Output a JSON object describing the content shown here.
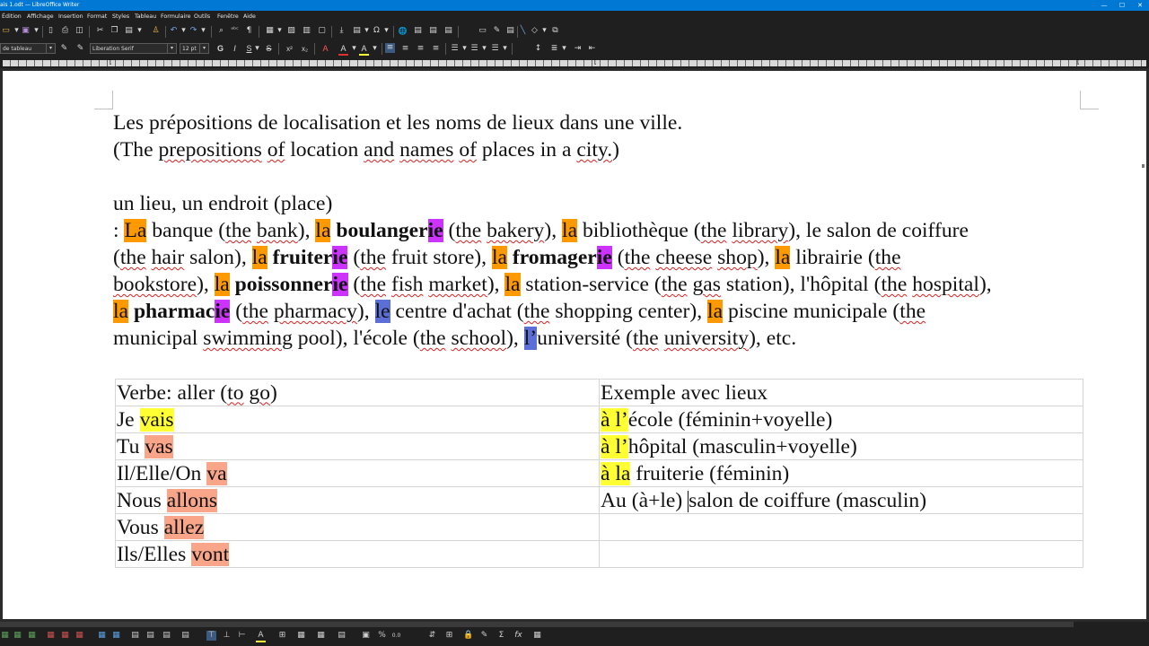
{
  "window": {
    "title": "ais 1.odt — LibreOffice Writer",
    "minimize_glyph": "—",
    "maximize_glyph": "☐",
    "close_glyph": "✕"
  },
  "menu": [
    "Édition",
    "Affichage",
    "Insertion",
    "Format",
    "Styles",
    "Tableau",
    "Formulaire",
    "Outils",
    "Fenêtre",
    "Aide"
  ],
  "toolbar": {
    "paragraph_style": "de tableau",
    "font_name": "Liberation Serif",
    "font_size": "12 pt",
    "bold": "G",
    "italic": "I",
    "underline": "S",
    "strikethrough": "S",
    "superscript": "x²",
    "subscript": "x₂",
    "font_color": "A",
    "highlight": "A"
  },
  "document": {
    "title_line1": "Les prépositions de localisation et les noms de lieux dans une ville.",
    "title_line2": {
      "a": "(The ",
      "b": "prepositions",
      "c": " ",
      "d": "of",
      "e": " location ",
      "f": "and",
      "g": " ",
      "h": "names",
      "i": " ",
      "j": "of",
      "k": " places in a ",
      "l": "city.",
      "m": ")"
    },
    "place_heading": "un lieu, un endroit (place)",
    "para": {
      "l1": {
        "a": ": ",
        "b": "La",
        "c": " banque (",
        "d": "the",
        "e": " ",
        "f": "bank",
        "g": "), ",
        "h": "la",
        "i": " ",
        "j": "boulanger",
        "k": "ie",
        "l": " (",
        "m": "the",
        "n": " ",
        "o": "bakery",
        "p": "), ",
        "q": "la",
        "r": " bibliothèque (",
        "s": "the",
        "t": " ",
        "u": "library",
        "v": "), le salon de coiffure"
      },
      "l2": {
        "a": "(",
        "b": "the",
        "c": " ",
        "d": "hair",
        "e": " salon), ",
        "f": "la",
        "g": " ",
        "h": "fruiter",
        "i": "ie",
        "j": " (",
        "k": "the",
        "l": " fruit store), ",
        "m": "la",
        "n": " ",
        "o": "fromager",
        "p": "ie",
        "q": " (",
        "r": "the",
        "s": " ",
        "t": "cheese",
        "u": " ",
        "v": "shop",
        "w": "), ",
        "x": "la",
        "y": " librairie (",
        "z": "the"
      },
      "l3": {
        "a": "bookstore",
        "b": "), ",
        "c": "la",
        "d": " ",
        "e": "poissonner",
        "f": "ie",
        "g": " (",
        "h": "the",
        "i": " ",
        "j": "fish",
        "k": " ",
        "l": "market",
        "m": "), ",
        "n": "la",
        "o": " station-service (",
        "p": "the",
        "q": " ",
        "r": "gas",
        "s": " station), l'hôpital (",
        "t": "the",
        "u": " ",
        "v": "hospital",
        "w": "),"
      },
      "l4": {
        "a": "la",
        "b": " ",
        "c": "pharmac",
        "d": "ie",
        "e": " (",
        "f": "the",
        "g": " ",
        "h": "pharmacy",
        "i": "), ",
        "j": "le",
        "k": " centre d'achat (",
        "l": "the",
        "m": " shopping center), ",
        "n": "la",
        "o": " piscine municipale (",
        "p": "the"
      },
      "l5": {
        "a": "municipal ",
        "b": "swimming",
        "c": " pool), l'école (",
        "d": "the",
        "e": " ",
        "f": "school",
        "g": "), ",
        "h": "l’",
        "i": "université (",
        "j": "the",
        "k": " ",
        "l": "university",
        "m": "), etc."
      }
    },
    "table": {
      "header": {
        "c1a": "Verbe: aller (",
        "c1b": "to",
        "c1c": " ",
        "c1d": "go",
        "c1e": ")",
        "c2": "Exemple avec lieux"
      },
      "rows": [
        {
          "pronoun": "Je ",
          "verb": "vais",
          "ex_hl": "à l’",
          "ex": "école  (féminin+voyelle)"
        },
        {
          "pronoun": "Tu ",
          "verb": "vas",
          "ex_hl": "à l’",
          "ex": "hôpital (masculin+voyelle)"
        },
        {
          "pronoun": "Il/Elle/On ",
          "verb": "va",
          "ex_hl": "à la",
          "ex": " fruiterie (féminin)"
        },
        {
          "pronoun": "Nous ",
          "verb": "allons",
          "ex_a": "Au (à+le) ",
          "ex_b": "salon de coiffure  (masculin)"
        },
        {
          "pronoun": "Vous ",
          "verb": "allez"
        },
        {
          "pronoun": "Ils/Elles ",
          "verb": "vont"
        }
      ]
    }
  },
  "colors": {
    "article_highlight": "#ff9900",
    "suffix_highlight": "#cc33ff",
    "masculine_highlight": "#5b6fd6",
    "example_highlight": "#ffff33",
    "verb_highlight": "#f9a58a",
    "titlebar": "#0078d4",
    "ui_dark": "#1f1f1f"
  },
  "icons": {
    "glyphs": {
      "open": "▭",
      "save": "▣",
      "dropdown": "▾",
      "new": "▯",
      "pdf": "▤",
      "print": "⎙",
      "preview": "◫",
      "cut": "✂",
      "copy": "❐",
      "paste": "▤",
      "clone": "♙",
      "undo": "↶",
      "redo": "↷",
      "find": "⌕",
      "spellcheck": "ᵃᵇᶜ",
      "formatting_marks": "¶",
      "table": "▦",
      "image": "▨",
      "chart": "▥",
      "textbox": "▢",
      "page_break": "⤓",
      "field": "▤",
      "special_char": "Ω",
      "hyperlink": "🌐",
      "footnote": "▤",
      "bookmark": "▤",
      "cross_reference": "▤",
      "comment": "▭",
      "track_changes": "✎",
      "header_footer": "▤",
      "line": "╲",
      "shapes": "◇",
      "more": "⧉",
      "style_new": "✎",
      "style_update": "✎",
      "align_left": "≡",
      "align_center": "≡",
      "align_right": "≡",
      "justify": "≡",
      "bullets": "☰",
      "numbering": "☰",
      "outline": "☰",
      "line_spacing": "↕",
      "para_spacing": "≣",
      "indent_inc": "⇥",
      "indent_dec": "⇤",
      "tab_marker": "⌊",
      "bottom": [
        "▦",
        "▦",
        "▦",
        "▦",
        "▦",
        "▦",
        "▦",
        "▦",
        "▦",
        "▦",
        "▦",
        "▤",
        "▤",
        "▤",
        "▤",
        "▤",
        "▤",
        "⊤",
        "⊥",
        "⊢",
        "A",
        "⊞",
        "▦",
        "▦",
        "▤",
        "▣",
        "%",
        "0.0",
        "⇵",
        "⊞",
        "🔒",
        "✎",
        "Σ",
        "fx",
        "▦"
      ]
    },
    "names": [
      "open-icon",
      "save-icon",
      "new-icon",
      "pdf-icon",
      "print-icon",
      "print-preview-icon",
      "cut-icon",
      "copy-icon",
      "paste-icon",
      "clone-icon",
      "undo-icon",
      "redo-icon",
      "find-replace-icon",
      "spellcheck-icon",
      "formatting-marks-icon",
      "table-icon",
      "image-icon",
      "chart-icon",
      "textbox-icon",
      "page-break-icon",
      "field-icon",
      "special-character-icon",
      "hyperlink-icon",
      "footnote-icon",
      "bookmark-icon",
      "cross-reference-icon",
      "comment-icon",
      "track-changes-icon",
      "header-footer-icon",
      "line-icon",
      "shapes-icon",
      "more-icon"
    ]
  }
}
